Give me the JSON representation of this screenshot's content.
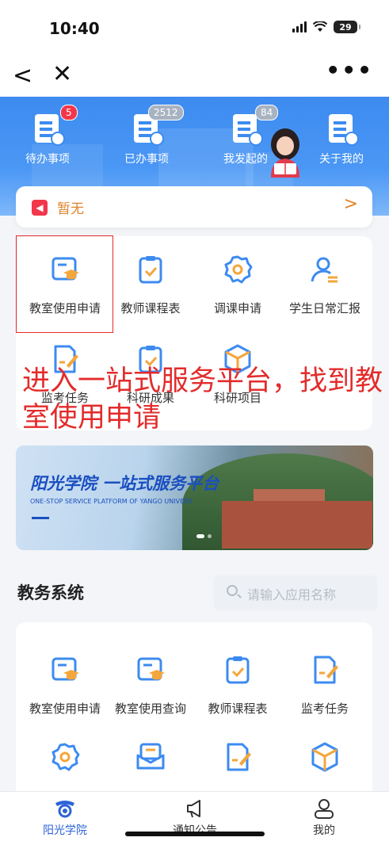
{
  "status_bar": {
    "time": "10:40",
    "battery": "29"
  },
  "nav": {
    "back_glyph": "<",
    "close_glyph": "✕",
    "more_glyph": "•••"
  },
  "quick_actions": [
    {
      "label": "待办事项",
      "badge": "5",
      "badge_style": "red",
      "icon": "pending-doc-clock-icon"
    },
    {
      "label": "已办事项",
      "badge": "2512",
      "badge_style": "gray",
      "icon": "done-doc-check-icon"
    },
    {
      "label": "我发起的",
      "badge": "84",
      "badge_style": "gray",
      "icon": "initiated-doc-flag-icon"
    },
    {
      "label": "关于我的",
      "badge": "",
      "badge_style": "",
      "icon": "about-me-doc-user-icon"
    }
  ],
  "notice": {
    "icon": "megaphone-icon",
    "text": "暂无",
    "arrow": ">"
  },
  "services": [
    {
      "label": "教室使用申请",
      "icon": "classroom-application-icon"
    },
    {
      "label": "教师课程表",
      "icon": "teacher-schedule-icon"
    },
    {
      "label": "调课申请",
      "icon": "reschedule-gear-icon"
    },
    {
      "label": "学生日常汇报",
      "icon": "student-report-icon"
    },
    {
      "label": "监考任务",
      "icon": "invigilation-task-icon"
    },
    {
      "label": "科研成果",
      "icon": "research-achievement-icon"
    },
    {
      "label": "科研项目",
      "icon": "research-project-icon"
    }
  ],
  "annotation": {
    "text": "进入一站式服务平台，找到教室使用申请"
  },
  "banner": {
    "title": "阳光学院 一站式服务平台",
    "subtitle": "ONE-STOP SERVICE PLATFORM OF YANGO UNIVERS"
  },
  "academic": {
    "title": "教务系统",
    "search_placeholder": "请输入应用名称",
    "items": [
      {
        "label": "教室使用申请",
        "icon": "classroom-application-icon"
      },
      {
        "label": "教室使用查询",
        "icon": "classroom-query-icon"
      },
      {
        "label": "教师课程表",
        "icon": "teacher-schedule-icon"
      },
      {
        "label": "监考任务",
        "icon": "invigilation-task-icon"
      },
      {
        "label": "",
        "icon": "settings-gear-icon"
      },
      {
        "label": "",
        "icon": "envelope-icon"
      },
      {
        "label": "",
        "icon": "doc-edit-icon"
      },
      {
        "label": "",
        "icon": "cube-icon"
      }
    ]
  },
  "tabbar": [
    {
      "label": "阳光学院",
      "icon": "campus-logo-icon",
      "active": true
    },
    {
      "label": "通知公告",
      "icon": "megaphone-icon",
      "active": false
    },
    {
      "label": "我的",
      "icon": "user-icon",
      "active": false
    }
  ],
  "colors": {
    "primary": "#3d8bf0",
    "accent_orange": "#f4a63c",
    "highlight_red": "#e32b2b",
    "tab_active": "#2c63d7"
  }
}
